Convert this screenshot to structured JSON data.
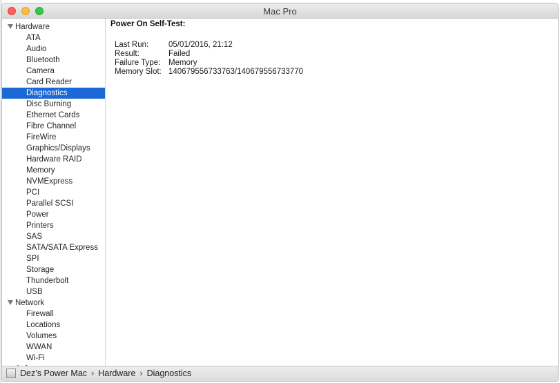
{
  "window": {
    "title": "Mac Pro"
  },
  "sidebar": {
    "groups": [
      {
        "label": "Hardware",
        "items": [
          "ATA",
          "Audio",
          "Bluetooth",
          "Camera",
          "Card Reader",
          "Diagnostics",
          "Disc Burning",
          "Ethernet Cards",
          "Fibre Channel",
          "FireWire",
          "Graphics/Displays",
          "Hardware RAID",
          "Memory",
          "NVMExpress",
          "PCI",
          "Parallel SCSI",
          "Power",
          "Printers",
          "SAS",
          "SATA/SATA Express",
          "SPI",
          "Storage",
          "Thunderbolt",
          "USB"
        ]
      },
      {
        "label": "Network",
        "items": [
          "Firewall",
          "Locations",
          "Volumes",
          "WWAN",
          "Wi-Fi"
        ]
      },
      {
        "label": "Software",
        "items": []
      }
    ],
    "selected": "Diagnostics"
  },
  "content": {
    "heading": "Power On Self-Test:",
    "rows": [
      {
        "key": "Last Run:",
        "value": "05/01/2016, 21:12"
      },
      {
        "key": "Result:",
        "value": "Failed"
      },
      {
        "key": "Failure Type:",
        "value": "Memory"
      },
      {
        "key": "Memory Slot:",
        "value": "140679556733763/140679556733770"
      }
    ]
  },
  "statusbar": {
    "icon": "mac-computer-icon",
    "path": [
      "Dez’s Power Mac",
      "Hardware",
      "Diagnostics"
    ]
  }
}
